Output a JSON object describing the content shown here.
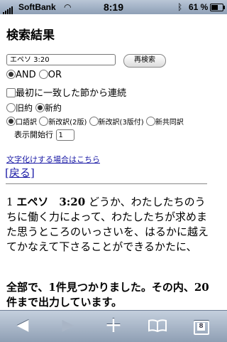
{
  "status": {
    "carrier": "SoftBank",
    "time": "8:19",
    "battery": "61 %"
  },
  "page": {
    "title": "検索結果",
    "search": {
      "value": "エペソ 3:20",
      "button": "再検索"
    },
    "logic": {
      "and": "AND",
      "or": "OR",
      "selected": "and"
    },
    "continuous": {
      "label": "最初に一致した節から連続",
      "checked": false
    },
    "testament": {
      "old": "旧約",
      "new": "新約",
      "selected": "new"
    },
    "versions": {
      "colloquial": "口語訳",
      "shin2": "新改訳(2版)",
      "shin3": "新改訳(3版付)",
      "kyodo": "新共同訳",
      "selected": "colloquial"
    },
    "start_line": {
      "label": "表示開始行",
      "value": "1"
    },
    "mojibake_link": "文字化けする場合はこちら",
    "back_link": "[戻る]",
    "result": {
      "number": "1",
      "ref": "エペソ　3:20",
      "text": "どうか、わたしたちのうちに働く力によって、わたしたちが求めまた思うところのいっさいを、はるかに越えてかなえて下さることができるかたに、"
    },
    "summary": "全部で、1件見つかりました。その内、20件まで出力しています。"
  },
  "toolbar": {
    "back": "◀",
    "forward": "▶",
    "add": "+",
    "bookmarks": "📖",
    "tabs_count": "8"
  }
}
